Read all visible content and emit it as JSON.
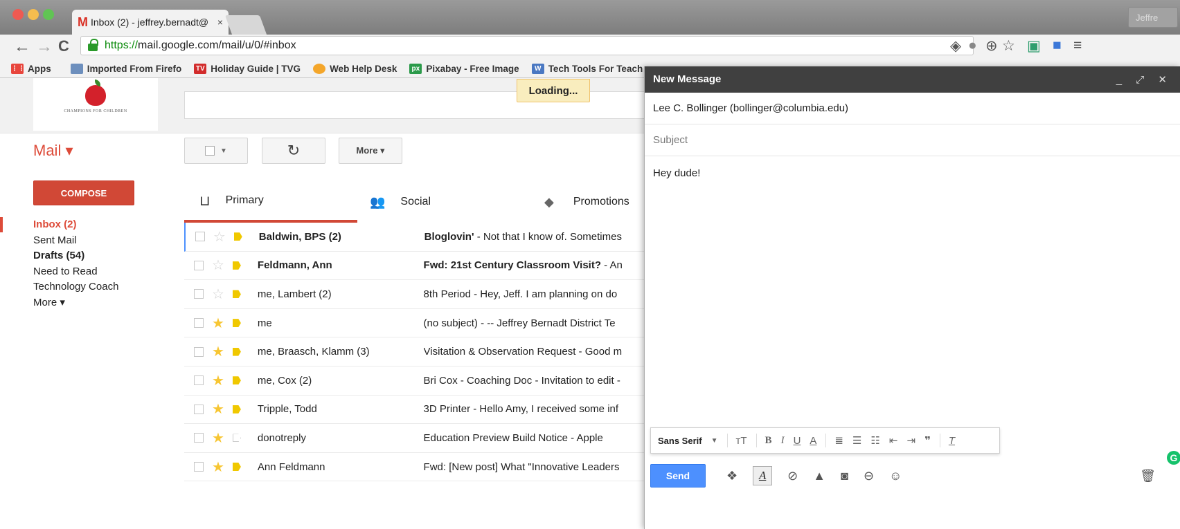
{
  "browser": {
    "tab_title": "Inbox (2) - jeffrey.bernadt@",
    "tab_close": "×",
    "profile": "Jeffre",
    "url_https": "https://",
    "url_rest": "mail.google.com/mail/u/0/#inbox",
    "bookmarks": [
      {
        "label": "Apps",
        "color": "#e8453c"
      },
      {
        "label": "Imported From Firefo",
        "color": "#6d8fbd"
      },
      {
        "label": "Holiday Guide | TVG",
        "color": "#d22c2c"
      },
      {
        "label": "Web Help Desk",
        "color": "#f4a62a"
      },
      {
        "label": "Pixabay - Free Image",
        "color": "#2b9a4a"
      },
      {
        "label": "Tech Tools For Teach",
        "color": "#4a78c2"
      }
    ]
  },
  "gmail": {
    "logo_text": "CHAMPIONS FOR CHILDREN",
    "loading": "Loading...",
    "mail_label": "Mail ▾",
    "compose": "COMPOSE",
    "more_button": "More ▾",
    "nav": [
      {
        "label": "Inbox (2)"
      },
      {
        "label": "Sent Mail"
      },
      {
        "label": "Drafts (54)"
      },
      {
        "label": "Need to Read"
      },
      {
        "label": "Technology Coach"
      },
      {
        "label": "More ▾"
      }
    ],
    "tabs": [
      {
        "label": "Primary"
      },
      {
        "label": "Social"
      },
      {
        "label": "Promotions"
      }
    ],
    "emails": [
      {
        "from": "Baldwin, BPS (2)",
        "subject_bold": "Bloglovin'",
        "snippet": " - Not that I know of. Sometimes",
        "starred": false,
        "important": true
      },
      {
        "from": "Feldmann, Ann",
        "subject_bold": "Fwd: 21st Century Classroom Visit?",
        "snippet": " - An",
        "starred": false,
        "important": true
      },
      {
        "from": "me, Lambert (2)",
        "subject_bold": "",
        "snippet": "8th Period - Hey, Jeff. I am planning on do",
        "starred": false,
        "important": true
      },
      {
        "from": "me",
        "subject_bold": "",
        "snippet": "(no subject) - -- Jeffrey Bernadt District Te",
        "starred": true,
        "important": true
      },
      {
        "from": "me, Braasch, Klamm (3)",
        "subject_bold": "",
        "snippet": "Visitation & Observation Request - Good m",
        "starred": true,
        "important": true
      },
      {
        "from": "me, Cox (2)",
        "subject_bold": "",
        "snippet": "Bri Cox - Coaching Doc - Invitation to edit -",
        "starred": true,
        "important": true
      },
      {
        "from": "Tripple, Todd",
        "subject_bold": "",
        "snippet": "3D Printer - Hello Amy, I received some inf",
        "starred": true,
        "important": true
      },
      {
        "from": "donotreply",
        "subject_bold": "",
        "snippet": "Education Preview Build Notice -  Apple",
        "starred": true,
        "important": false
      },
      {
        "from": "Ann Feldmann",
        "subject_bold": "",
        "snippet": "Fwd: [New post] What \"Innovative Leaders",
        "starred": true,
        "important": true
      }
    ]
  },
  "compose_window": {
    "title": "New Message",
    "controls": "_ ⤢ ✕",
    "to": "Lee C. Bollinger (bollinger@columbia.edu)",
    "subject_placeholder": "Subject",
    "body": "Hey dude!",
    "font": "Sans Serif",
    "send": "Send",
    "grammarly": "G"
  }
}
